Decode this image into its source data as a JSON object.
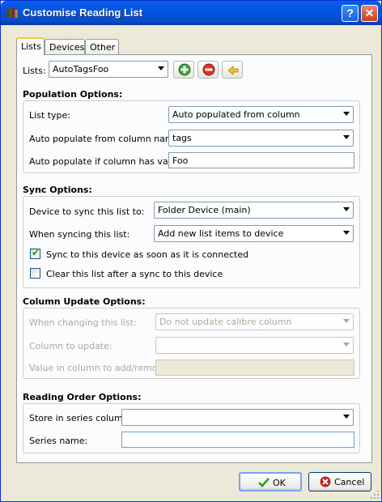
{
  "window": {
    "title": "Customise Reading List",
    "help_label": "?",
    "close_label": "✕"
  },
  "tabs": [
    {
      "label": "Lists"
    },
    {
      "label": "Devices"
    },
    {
      "label": "Other"
    }
  ],
  "lists_row": {
    "label": "Lists:",
    "selected": "AutoTagsFoo",
    "icons": [
      "add-list-icon",
      "remove-list-icon",
      "rename-list-icon"
    ]
  },
  "population": {
    "title": "Population Options:",
    "list_type_label": "List type:",
    "list_type_value": "Auto populated from column",
    "column_name_label": "Auto populate from column name:",
    "column_name_value": "tags",
    "has_value_label": "Auto populate if column has value:",
    "has_value_value": "Foo"
  },
  "sync": {
    "title": "Sync Options:",
    "device_label": "Device to sync this list to:",
    "device_value": "Folder Device (main)",
    "when_label": "When syncing this list:",
    "when_value": "Add new list items to device",
    "sync_connected_label": "Sync to this device as soon as it is connected",
    "sync_connected_checked": true,
    "clear_after_label": "Clear this list after a sync to this device",
    "clear_after_checked": false
  },
  "column_update": {
    "title": "Column Update Options:",
    "when_label": "When changing this list:",
    "when_value": "Do not update calibre column",
    "column_label": "Column to update:",
    "column_value": "",
    "value_label": "Value in column to add/remove:",
    "value_value": ""
  },
  "reading_order": {
    "title": "Reading Order Options:",
    "series_column_label": "Store in series column:",
    "series_column_value": "",
    "series_name_label": "Series name:",
    "series_name_value": ""
  },
  "buttons": {
    "ok_label": "OK",
    "cancel_label": "Cancel"
  },
  "colors": {
    "title_bar": "#0054e3",
    "dialog_bg": "#ece9d8",
    "ok_check": "#21a121",
    "cancel_red": "#c8201e"
  }
}
